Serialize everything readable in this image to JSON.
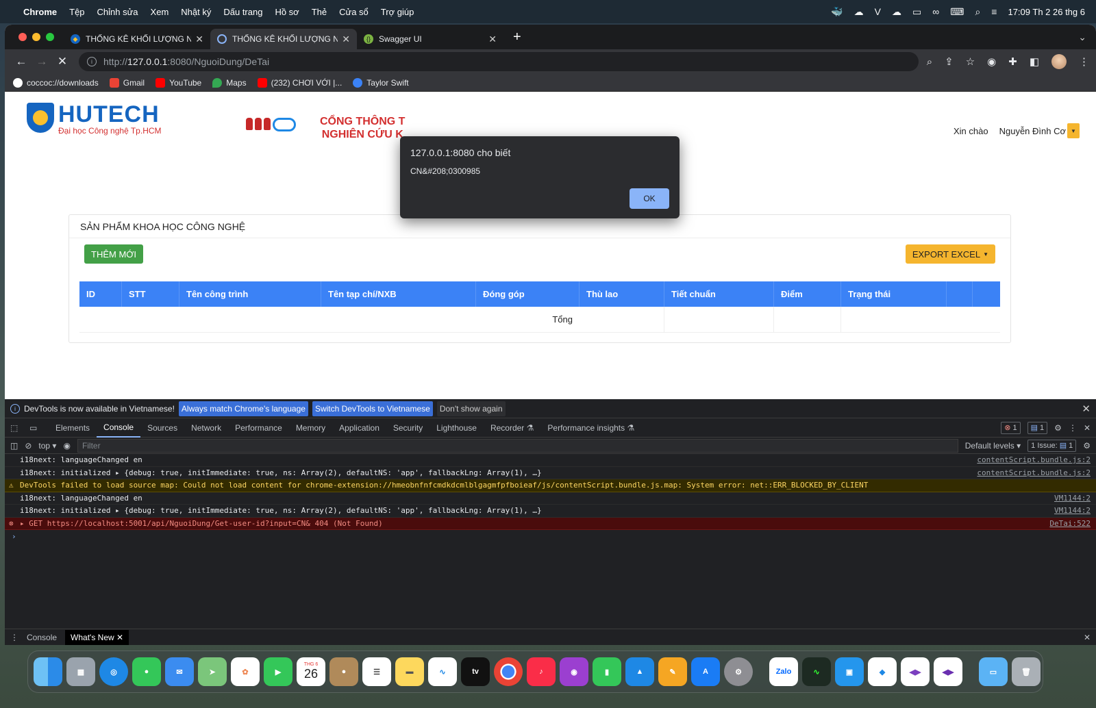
{
  "menubar": {
    "app": "Chrome",
    "items": [
      "Tệp",
      "Chỉnh sửa",
      "Xem",
      "Nhật ký",
      "Dấu trang",
      "Hồ sơ",
      "Thẻ",
      "Cửa sổ",
      "Trợ giúp"
    ],
    "clock": "17:09 Th 2 26 thg 6"
  },
  "tabs": [
    {
      "title": "THỐNG KÊ KHỐI LƯỢNG NCKH",
      "active": false
    },
    {
      "title": "THỐNG KÊ KHỐI LƯỢNG NCKH",
      "active": true
    },
    {
      "title": "Swagger UI",
      "active": false
    }
  ],
  "address": {
    "scheme": "http://",
    "host": "127.0.0.1",
    "rest": ":8080/NguoiDung/DeTai"
  },
  "bookmarks": [
    "coccoc://downloads",
    "Gmail",
    "YouTube",
    "Maps",
    "(232) CHƠI VỚI |...",
    "Taylor Swift"
  ],
  "page": {
    "logo_name": "HUTECH",
    "logo_sub": "Đại học Công nghệ Tp.HCM",
    "banner_line1": "CỔNG THÔNG T",
    "banner_line2": "NGHIÊN CỨU K",
    "greeting": "Xin chào",
    "user_name": "Nguyễn Đình Cơ",
    "card_title": "SẢN PHẨM KHOA HỌC CÔNG NGHỆ",
    "add_button": "THÊM MỚI",
    "export_button": "EXPORT EXCEL",
    "columns": [
      "ID",
      "STT",
      "Tên công trình",
      "Tên tạp chí/NXB",
      "Đóng góp",
      "Thù lao",
      "Tiết chuẩn",
      "Điểm",
      "Trạng thái",
      "",
      ""
    ],
    "total_label": "Tổng"
  },
  "alert": {
    "title": "127.0.0.1:8080 cho biết",
    "message": "CN&#208;0300985",
    "ok": "OK"
  },
  "devtools": {
    "info_text": "DevTools is now available in Vietnamese!",
    "btn_match": "Always match Chrome's language",
    "btn_switch": "Switch DevTools to Vietnamese",
    "btn_dismiss": "Don't show again",
    "tabs": [
      "Elements",
      "Console",
      "Sources",
      "Network",
      "Performance",
      "Memory",
      "Application",
      "Security",
      "Lighthouse",
      "Recorder",
      "Performance insights"
    ],
    "error_count": "1",
    "msg_count": "1",
    "context": "top",
    "filter_placeholder": "Filter",
    "levels": "Default levels",
    "issues": "1 Issue:",
    "issues_count": "1",
    "lines": [
      {
        "kind": "log",
        "text": "i18next: languageChanged en",
        "src": "contentScript.bundle.js:2"
      },
      {
        "kind": "log",
        "text": "i18next: initialized  ▸ {debug: true, initImmediate: true, ns: Array(2), defaultNS: 'app', fallbackLng: Array(1), …}",
        "src": "contentScript.bundle.js:2"
      },
      {
        "kind": "warn",
        "text": "DevTools failed to load source map: Could not load content for chrome-extension://hmeobnfnfcmdkdcmlblgagmfpfboieaf/js/contentScript.bundle.js.map: System error: net::ERR_BLOCKED_BY_CLIENT",
        "src": ""
      },
      {
        "kind": "log",
        "text": "i18next: languageChanged en",
        "src": "VM1144:2"
      },
      {
        "kind": "log",
        "text": "i18next: initialized  ▸ {debug: true, initImmediate: true, ns: Array(2), defaultNS: 'app', fallbackLng: Array(1), …}",
        "src": "VM1144:2"
      },
      {
        "kind": "err",
        "text": "▸ GET https://localhost:5001/api/NguoiDung/Get-user-id?input=CN& 404 (Not Found)",
        "src": "DeTai:522"
      }
    ],
    "drawer_tabs": [
      "Console",
      "What's New"
    ]
  },
  "colors": {
    "primary_blue": "#3b82f6",
    "green": "#43a047",
    "yellow": "#f5b52e",
    "hutech_blue": "#1565c0",
    "hutech_red": "#d32f2f"
  },
  "dock": [
    "Finder",
    "Launchpad",
    "Safari",
    "Messages",
    "Mail",
    "Maps",
    "Photos",
    "FaceTime",
    "Calendar",
    "Contacts",
    "Reminders",
    "Notes",
    "Freeform",
    "TV",
    "Chrome",
    "Music",
    "Podcasts",
    "Numbers",
    "Keynote",
    "Pages",
    "App Store",
    "System Settings",
    "Zalo",
    "Activity Monitor",
    "Docker",
    "Azure Data Studio",
    "Visual Studio",
    "Visual Studio Preview",
    "Downloads",
    "Trash"
  ],
  "calendar": {
    "month": "THG 6",
    "day": "26"
  }
}
